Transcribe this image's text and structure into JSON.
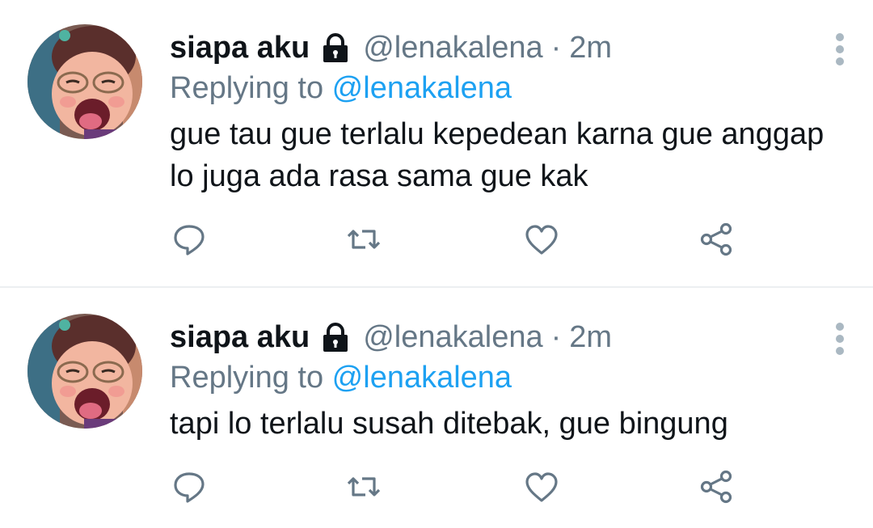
{
  "tweets": [
    {
      "display_name": "siapa aku",
      "lock_icon": "lock-icon",
      "handle": "@lenakalena",
      "separator": "·",
      "time": "2m",
      "replying_prefix": "Replying to ",
      "replying_to": "@lenakalena",
      "text": "gue tau gue terlalu kepedean karna gue anggap lo juga ada rasa sama gue kak"
    },
    {
      "display_name": "siapa aku",
      "lock_icon": "lock-icon",
      "handle": "@lenakalena",
      "separator": "·",
      "time": "2m",
      "replying_prefix": "Replying to ",
      "replying_to": "@lenakalena",
      "text": "tapi lo terlalu susah ditebak, gue bingung"
    }
  ],
  "actions": [
    "reply-icon",
    "retweet-icon",
    "like-icon",
    "share-icon"
  ],
  "colors": {
    "text": "#0f1419",
    "secondary": "#657786",
    "link": "#1da1f2",
    "icon": "#657786",
    "divider": "#eceff1"
  }
}
